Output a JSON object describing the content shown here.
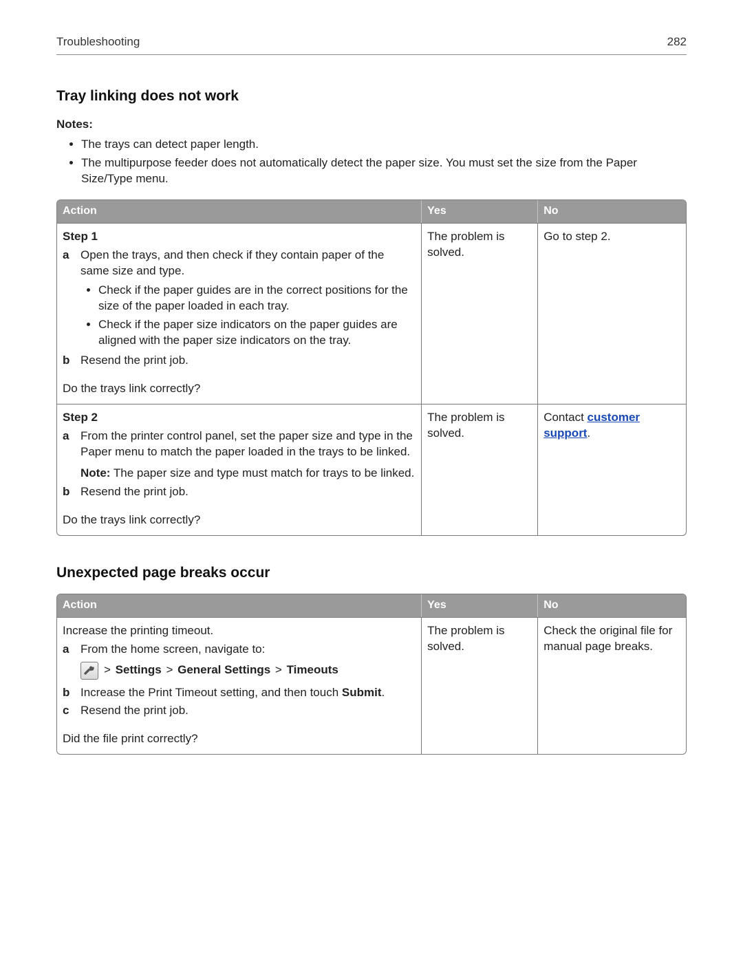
{
  "header": {
    "section": "Troubleshooting",
    "page_number": "282"
  },
  "section1": {
    "title": "Tray linking does not work",
    "notes_label": "Notes:",
    "notes": [
      "The trays can detect paper length.",
      "The multipurpose feeder does not automatically detect the paper size. You must set the size from the Paper Size/Type menu."
    ],
    "table": {
      "col_action": "Action",
      "col_yes": "Yes",
      "col_no": "No",
      "row1": {
        "step_label": "Step 1",
        "a_marker": "a",
        "a_text": "Open the trays, and then check if they contain paper of the same size and type.",
        "a_sub1": "Check if the paper guides are in the correct positions for the size of the paper loaded in each tray.",
        "a_sub2": "Check if the paper size indicators on the paper guides are aligned with the paper size indicators on the tray.",
        "b_marker": "b",
        "b_text": "Resend the print job.",
        "question": "Do the trays link correctly?",
        "yes": "The problem is solved.",
        "no": "Go to step 2."
      },
      "row2": {
        "step_label": "Step 2",
        "a_marker": "a",
        "a_text": "From the printer control panel, set the paper size and type in the Paper menu to match the paper loaded in the trays to be linked.",
        "note_label": "Note:",
        "note_text": " The paper size and type must match for trays to be linked.",
        "b_marker": "b",
        "b_text": "Resend the print job.",
        "question": "Do the trays link correctly?",
        "yes": "The problem is solved.",
        "no_prefix": "Contact ",
        "no_link": "customer support",
        "no_suffix": "."
      }
    }
  },
  "section2": {
    "title": "Unexpected page breaks occur",
    "table": {
      "col_action": "Action",
      "col_yes": "Yes",
      "col_no": "No",
      "row1": {
        "intro": "Increase the printing timeout.",
        "a_marker": "a",
        "a_text": "From the home screen, navigate to:",
        "nav_sep": " > ",
        "nav1": "Settings",
        "nav2": "General Settings",
        "nav3": "Timeouts",
        "b_marker": "b",
        "b_text_pre": "Increase the Print Timeout setting, and then touch ",
        "b_text_bold": "Submit",
        "b_text_post": ".",
        "c_marker": "c",
        "c_text": "Resend the print job.",
        "question": "Did the file print correctly?",
        "yes": "The problem is solved.",
        "no": "Check the original file for manual page breaks."
      }
    }
  }
}
